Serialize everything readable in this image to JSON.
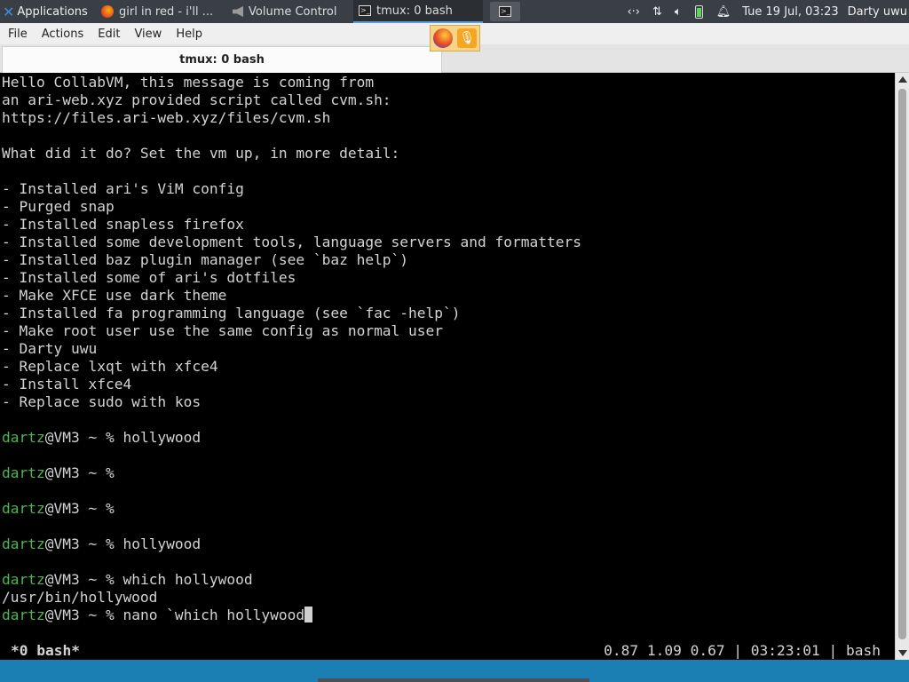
{
  "panel": {
    "applications_label": "Applications",
    "tasks": [
      {
        "label": "girl in red - i'll ..."
      },
      {
        "label": "Volume Control"
      },
      {
        "label": "tmux: 0 bash"
      }
    ],
    "clock": "Tue 19 Jul, 03:23",
    "user": "Darty uwu"
  },
  "menubar": {
    "items": [
      "File",
      "Actions",
      "Edit",
      "View",
      "Help"
    ]
  },
  "window": {
    "tab_title": "tmux: 0 bash"
  },
  "terminal": {
    "lines": [
      "Hello CollabVM, this message is coming from",
      "an ari-web.xyz provided script called cvm.sh:",
      "https://files.ari-web.xyz/files/cvm.sh",
      "",
      "What did it do? Set the vm up, in more detail:",
      "",
      "- Installed ari's ViM config",
      "- Purged snap",
      "- Installed snapless firefox",
      "- Installed some development tools, language servers and formatters",
      "- Installed baz plugin manager (see `baz help`)",
      "- Installed some of ari's dotfiles",
      "- Make XFCE use dark theme",
      "- Installed fa programming language (see `fac -help`)",
      "- Make root user use the same config as normal user",
      "- Darty uwu",
      "- Replace lxqt with xfce4",
      "- Install xfce4",
      "- Replace sudo with kos",
      ""
    ],
    "prompt_user": "dartz",
    "prompt_rest": "@VM3 ~ % ",
    "commands": [
      {
        "cmd": "hollywood",
        "output": ""
      },
      {
        "cmd": "",
        "output": ""
      },
      {
        "cmd": "",
        "output": ""
      },
      {
        "cmd": "hollywood",
        "output": ""
      },
      {
        "cmd": "which hollywood",
        "output": "/usr/bin/hollywood"
      }
    ],
    "current_command": "nano `which hollywood"
  },
  "statusline": {
    "window": "*0 bash*",
    "right": "0.87 1.09 0.67 | 03:23:01 | bash"
  },
  "icons": {
    "apps": "xfce-icon",
    "network": "network-icon",
    "volume": "volume-icon",
    "battery": "battery-icon",
    "notifications": "bell-icon"
  }
}
